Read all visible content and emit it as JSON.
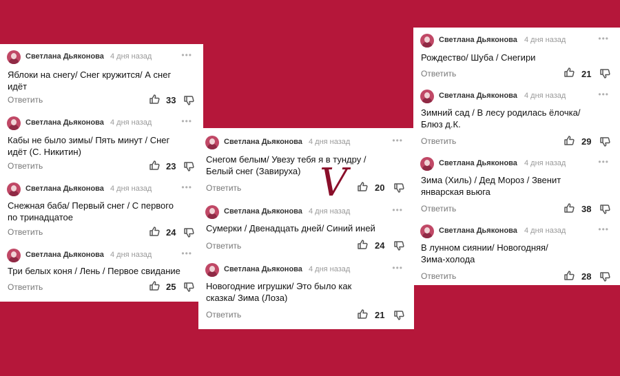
{
  "colors": {
    "background": "#b5173a",
    "panel": "#ffffff",
    "reply": "#777777",
    "time": "#9a9a9a"
  },
  "separator_letter": "V",
  "panels": [
    {
      "comments": [
        {
          "author": "Светлана Дьяконова",
          "time": "4 дня назад",
          "text": [
            "Яблоки на снегу/ Снег кружится/ А снег",
            "идёт"
          ],
          "reply": "Ответить",
          "likes": "33"
        },
        {
          "author": "Светлана Дьяконова",
          "time": "4 дня назад",
          "text": [
            "Кабы не было зимы/ Пять минут / Снег",
            "идёт (С. Никитин)"
          ],
          "reply": "Ответить",
          "likes": "23"
        },
        {
          "author": "Светлана Дьяконова",
          "time": "4 дня назад",
          "text": [
            "Снежная баба/  Первый снег / С первого",
            "по тринадцатое"
          ],
          "reply": "Ответить",
          "likes": "24"
        },
        {
          "author": "Светлана Дьяконова",
          "time": "4 дня назад",
          "text": [
            "Три белых коня / Лень / Первое свидание"
          ],
          "reply": "Ответить",
          "likes": "25"
        }
      ]
    },
    {
      "comments": [
        {
          "author": "Светлана Дьяконова",
          "time": "4 дня назад",
          "text": [
            "Снегом белым/ Увезу тебя я в тундру /",
            "Белый снег (Завируха)"
          ],
          "reply": "Ответить",
          "likes": "20"
        },
        {
          "author": "Светлана Дьяконова",
          "time": "4 дня назад",
          "text": [
            "Сумерки / Двенадцать дней/ Синий иней"
          ],
          "reply": "Ответить",
          "likes": "24"
        },
        {
          "author": "Светлана Дьяконова",
          "time": "4 дня назад",
          "text": [
            "Новогодние игрушки/ Это было как",
            "сказка/ Зима (Лоза)"
          ],
          "reply": "Ответить",
          "likes": "21"
        }
      ]
    },
    {
      "comments": [
        {
          "author": "Светлана Дьяконова",
          "time": "4 дня назад",
          "text": [
            "Рождество/ Шуба / Снегири"
          ],
          "reply": "Ответить",
          "likes": "21"
        },
        {
          "author": "Светлана Дьяконова",
          "time": "4 дня назад",
          "text": [
            "Зимний сад / В лесу родилась ёлочка/",
            "Блюз д.К."
          ],
          "reply": "Ответить",
          "likes": "29"
        },
        {
          "author": "Светлана Дьяконова",
          "time": "4 дня назад",
          "text": [
            "Зима (Хиль) / Дед Мороз / Звенит",
            "январская вьюга"
          ],
          "reply": "Ответить",
          "likes": "38"
        },
        {
          "author": "Светлана Дьяконова",
          "time": "4 дня назад",
          "text": [
            "В лунном сиянии/  Новогодняя/",
            "Зима-холода"
          ],
          "reply": "Ответить",
          "likes": "28"
        }
      ]
    }
  ]
}
